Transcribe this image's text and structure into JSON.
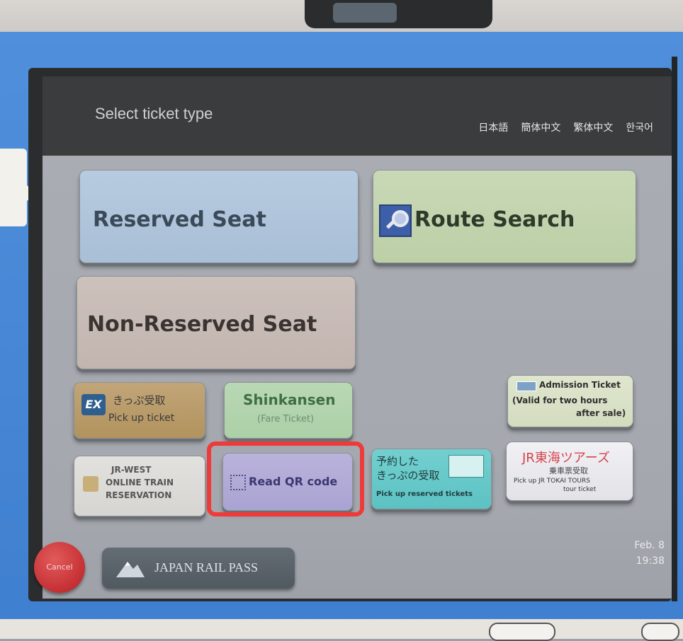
{
  "header": {
    "title": "Select ticket type",
    "languages": [
      "日本語",
      "簡体中文",
      "繁体中文",
      "한국어"
    ]
  },
  "buttons": {
    "reserved_seat": "Reserved Seat",
    "route_search": "Route Search",
    "non_reserved_seat": "Non-Reserved Seat",
    "ex_pickup": {
      "logo": "EX",
      "line1": "きっぷ受取",
      "line2": "Pick up ticket"
    },
    "shinkansen": {
      "line1": "Shinkansen",
      "line2": "(Fare Ticket)"
    },
    "admission": {
      "line1": "Admission Ticket",
      "line2": "(Valid for two hours",
      "line3": "after sale)"
    },
    "jr_west": {
      "line1": "JR-WEST",
      "line2": "ONLINE TRAIN",
      "line3": "RESERVATION"
    },
    "read_qr": "Read QR code",
    "reserved_pickup": {
      "line1": "予約した",
      "line2": "きっぷの受取",
      "line3": "Pick up reserved tickets"
    },
    "jr_tokai_tours": {
      "line1": "JR東海ツアーズ",
      "line2": "乗車票受取",
      "line3": "Pick up JR TOKAI TOURS",
      "line4": "tour ticket"
    }
  },
  "footer": {
    "cancel": "Cancel",
    "rail_pass": "JAPAN RAIL PASS",
    "date": "Feb. 8",
    "time": "19:38"
  },
  "colors": {
    "highlight": "#ef3a3a",
    "bezel": "#4f8fdb"
  }
}
